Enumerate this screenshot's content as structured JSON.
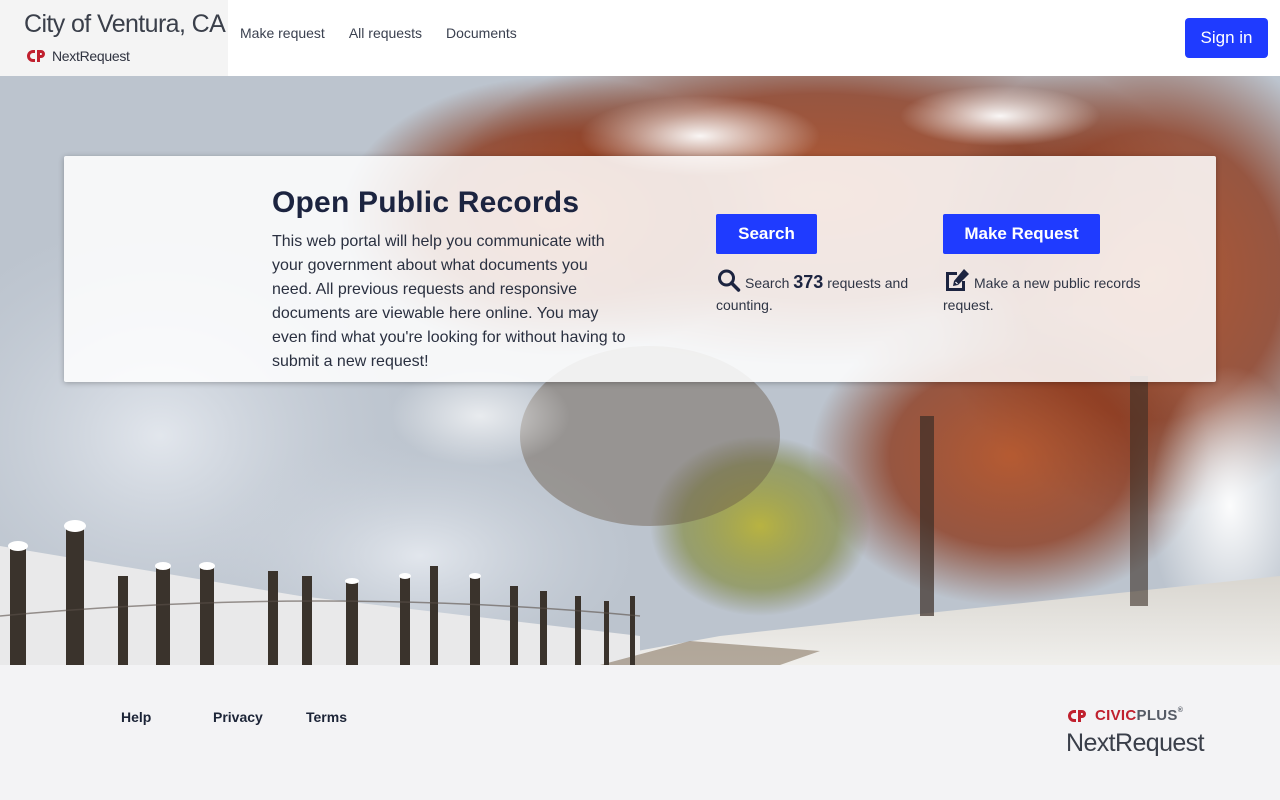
{
  "header": {
    "city_title": "City of Ventura, CA",
    "product_name": "NextRequest",
    "nav": [
      {
        "label": "Make request"
      },
      {
        "label": "All requests"
      },
      {
        "label": "Documents"
      }
    ],
    "sign_in_label": "Sign in"
  },
  "hero": {
    "title": "Open Public Records",
    "description": "This web portal will help you communicate with your government about what documents you need. All previous requests and responsive documents are viewable here online. You may even find what you're looking for without having to submit a new request!",
    "search": {
      "button_label": "Search",
      "desc_prefix": "Search",
      "count": "373",
      "desc_suffix": "requests and counting.",
      "icon": "search-icon"
    },
    "request": {
      "button_label": "Make Request",
      "desc": "Make a new public records request.",
      "icon": "edit-icon"
    }
  },
  "footer": {
    "links": [
      {
        "label": "Help"
      },
      {
        "label": "Privacy"
      },
      {
        "label": "Terms"
      }
    ],
    "civic_brand": "CIVIC",
    "civic_brand_plus": "PLUS",
    "trademark": "®",
    "product_name": "NextRequest"
  },
  "colors": {
    "primary": "#1f3bff",
    "brand_red": "#c0202e",
    "text_dark": "#1c2440"
  }
}
